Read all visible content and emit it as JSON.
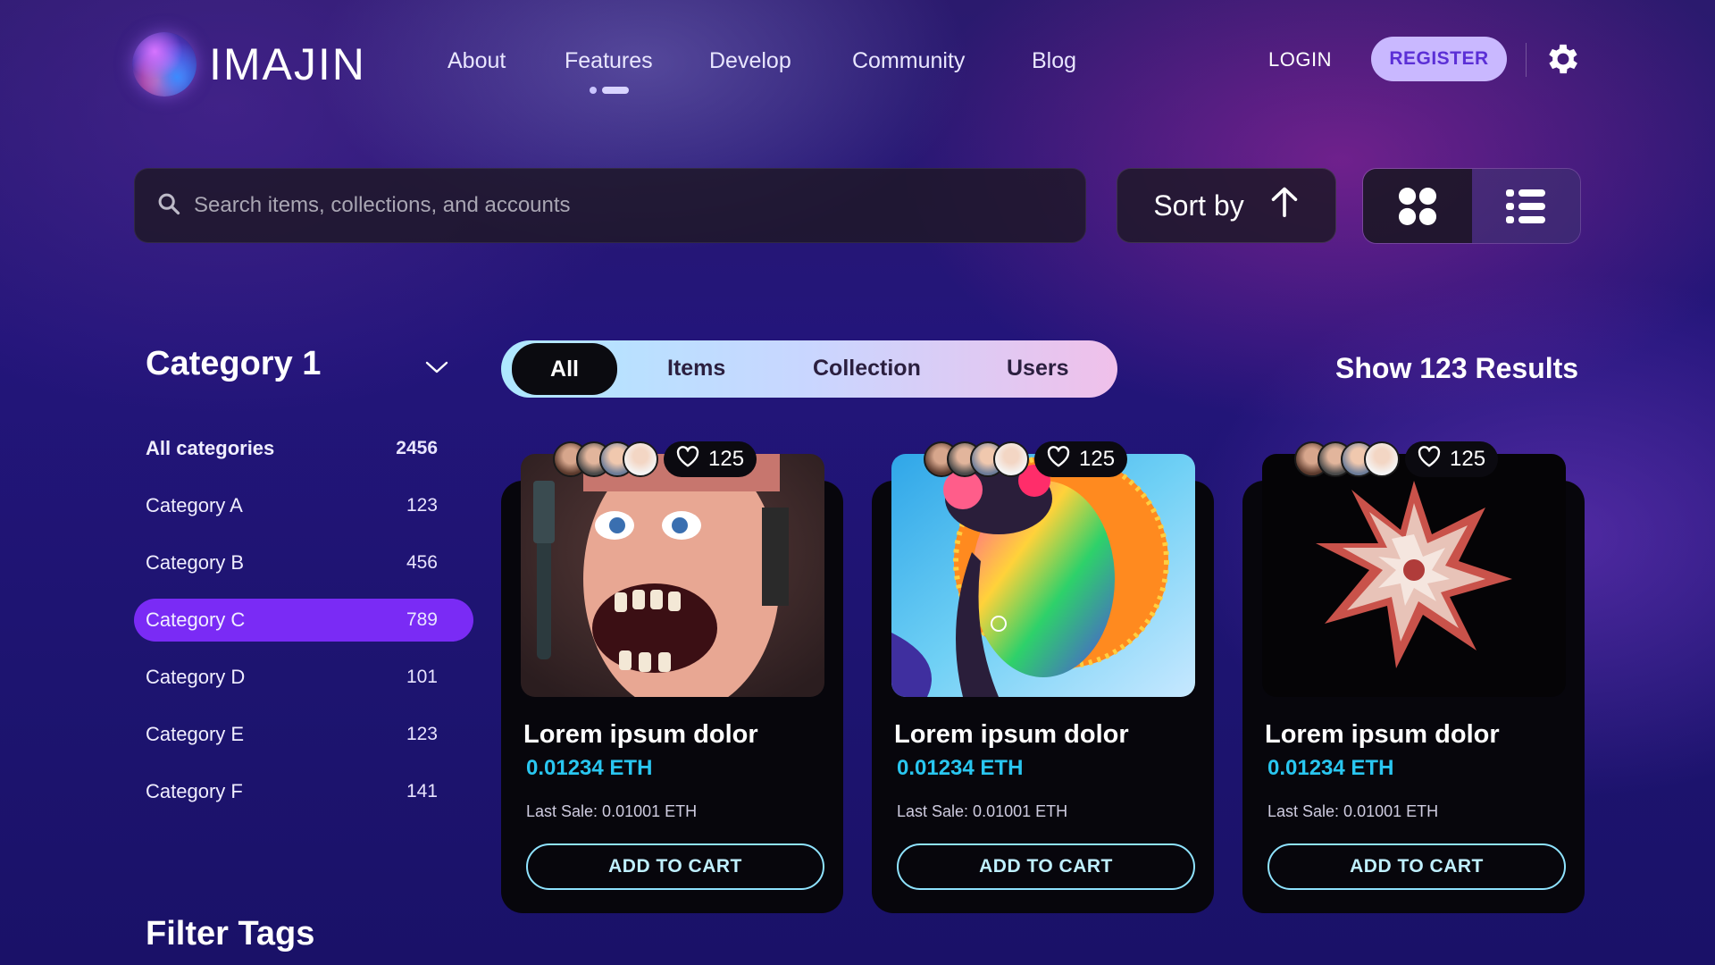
{
  "brand": {
    "name": "IMAJIN"
  },
  "nav": {
    "items": [
      "About",
      "Features",
      "Develop",
      "Community",
      "Blog"
    ],
    "active": "Features"
  },
  "auth": {
    "login": "LOGIN",
    "register": "REGISTER"
  },
  "icons": {
    "settings": "gear-icon",
    "search": "search-icon",
    "sort": "arrow-up-icon",
    "grid": "grid-view-icon",
    "list": "list-view-icon",
    "like": "heart-icon"
  },
  "search": {
    "placeholder": "Search items, collections, and accounts",
    "value": ""
  },
  "sort": {
    "label": "Sort by"
  },
  "view": {
    "active": "grid"
  },
  "sidebar": {
    "category_title": "Category 1",
    "categories": [
      {
        "label": "All categories",
        "count": "2456"
      },
      {
        "label": "Category A",
        "count": "123"
      },
      {
        "label": "Category B",
        "count": "456"
      },
      {
        "label": "Category C",
        "count": "789"
      },
      {
        "label": "Category D",
        "count": "101"
      },
      {
        "label": "Category E",
        "count": "123"
      },
      {
        "label": "Category F",
        "count": "141"
      }
    ],
    "active_category": "Category C",
    "filter_tags_title": "Filter Tags"
  },
  "tabs": {
    "items": [
      "All",
      "Items",
      "Collection",
      "Users"
    ],
    "active": "All"
  },
  "results": {
    "label": "Show 123 Results"
  },
  "cards": [
    {
      "title": "Lorem ipsum dolor",
      "price": "0.01234 ETH",
      "last_sale": "Last Sale: 0.01001 ETH",
      "likes": "125",
      "button": "ADD TO CART"
    },
    {
      "title": "Lorem ipsum dolor",
      "price": "0.01234 ETH",
      "last_sale": "Last Sale: 0.01001 ETH",
      "likes": "125",
      "button": "ADD TO CART"
    },
    {
      "title": "Lorem ipsum dolor",
      "price": "0.01234 ETH",
      "last_sale": "Last Sale: 0.01001 ETH",
      "likes": "125",
      "button": "ADD TO CART"
    }
  ],
  "colors": {
    "accent": "#7a2bf5",
    "price": "#29c6f0",
    "register_bg": "#c9b8ff",
    "register_text": "#5b2fd6"
  }
}
